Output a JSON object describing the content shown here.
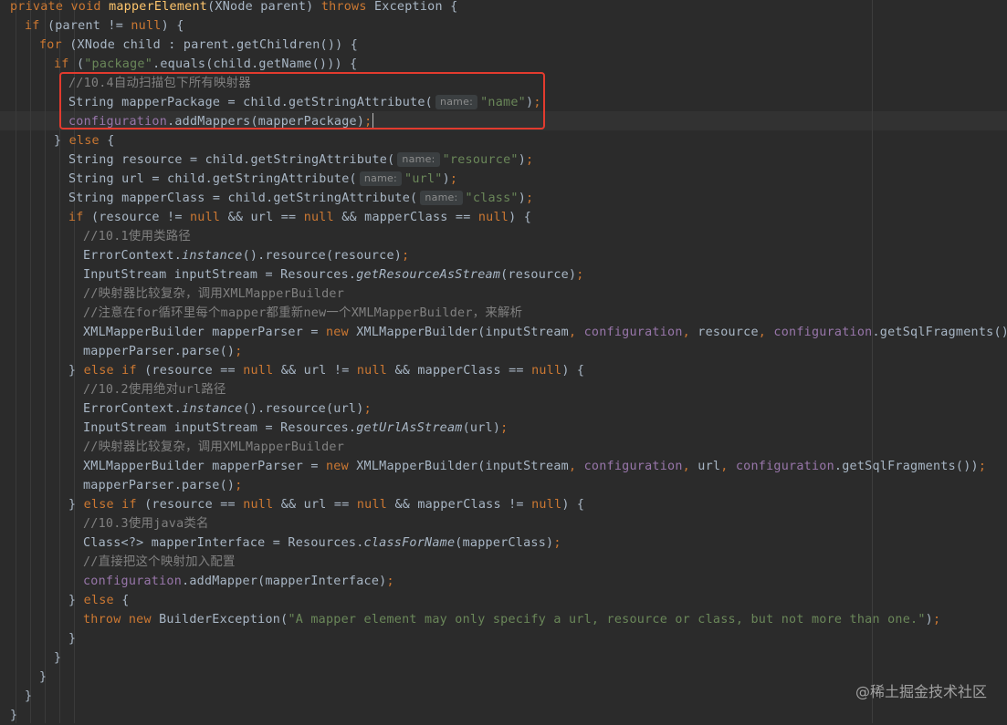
{
  "watermark": "@稀土掘金技术社区",
  "code": [
    [
      [
        "kw",
        "private void "
      ],
      [
        "fn",
        "mapperElement"
      ],
      [
        "p",
        "(XNode parent) "
      ],
      [
        "kw",
        "throws "
      ],
      [
        "p",
        "Exception {"
      ]
    ],
    [
      [
        "kw",
        "if "
      ],
      [
        "p",
        "(parent != "
      ],
      [
        "kw",
        "null"
      ],
      [
        "p",
        ") {"
      ]
    ],
    [
      [
        "kw",
        "for "
      ],
      [
        "p",
        "(XNode child : parent.getChildren()) {"
      ]
    ],
    [
      [
        "kw",
        "if "
      ],
      [
        "p",
        "("
      ],
      [
        "str",
        "\"package\""
      ],
      [
        "p",
        ".equals(child.getName())) {"
      ]
    ],
    [
      [
        "cm",
        "//10.4自动扫描包下所有映射器"
      ]
    ],
    [
      [
        "p",
        "String mapperPackage = child.getStringAttribute("
      ],
      [
        "hint",
        "name:"
      ],
      [
        "str",
        "\"name\""
      ],
      [
        "p",
        ")"
      ],
      [
        "kw",
        ";"
      ]
    ],
    [
      [
        "fld",
        "configuration"
      ],
      [
        "p",
        ".addMappers(mapperPackage)"
      ],
      [
        "kw",
        ";"
      ],
      [
        "caret",
        ""
      ]
    ],
    [
      [
        "p",
        "} "
      ],
      [
        "kw",
        "else "
      ],
      [
        "p",
        "{"
      ]
    ],
    [
      [
        "p",
        "String resource = child.getStringAttribute("
      ],
      [
        "hint",
        "name:"
      ],
      [
        "str",
        "\"resource\""
      ],
      [
        "p",
        ")"
      ],
      [
        "kw",
        ";"
      ]
    ],
    [
      [
        "p",
        "String url = child.getStringAttribute("
      ],
      [
        "hint",
        "name:"
      ],
      [
        "str",
        "\"url\""
      ],
      [
        "p",
        ")"
      ],
      [
        "kw",
        ";"
      ]
    ],
    [
      [
        "p",
        "String mapperClass = child.getStringAttribute("
      ],
      [
        "hint",
        "name:"
      ],
      [
        "str",
        "\"class\""
      ],
      [
        "p",
        ")"
      ],
      [
        "kw",
        ";"
      ]
    ],
    [
      [
        "kw",
        "if "
      ],
      [
        "p",
        "(resource != "
      ],
      [
        "kw",
        "null "
      ],
      [
        "p",
        "&& url == "
      ],
      [
        "kw",
        "null "
      ],
      [
        "p",
        "&& mapperClass == "
      ],
      [
        "kw",
        "null"
      ],
      [
        "p",
        ") {"
      ]
    ],
    [
      [
        "cm",
        "//10.1使用类路径"
      ]
    ],
    [
      [
        "p",
        "ErrorContext."
      ],
      [
        "it",
        "instance"
      ],
      [
        "p",
        "().resource(resource)"
      ],
      [
        "kw",
        ";"
      ]
    ],
    [
      [
        "p",
        "InputStream inputStream = Resources."
      ],
      [
        "it",
        "getResourceAsStream"
      ],
      [
        "p",
        "(resource)"
      ],
      [
        "kw",
        ";"
      ]
    ],
    [
      [
        "cm",
        "//映射器比较复杂，调用XMLMapperBuilder"
      ]
    ],
    [
      [
        "cm",
        "//注意在for循环里每个mapper都重新new一个XMLMapperBuilder，来解析"
      ]
    ],
    [
      [
        "p",
        "XMLMapperBuilder mapperParser = "
      ],
      [
        "kw",
        "new "
      ],
      [
        "p",
        "XMLMapperBuilder(inputStream"
      ],
      [
        "kw",
        ", "
      ],
      [
        "fld",
        "configuration"
      ],
      [
        "kw",
        ", "
      ],
      [
        "p",
        "resource"
      ],
      [
        "kw",
        ", "
      ],
      [
        "fld",
        "configuration"
      ],
      [
        "p",
        ".getSqlFragments())"
      ],
      [
        "kw",
        ";"
      ]
    ],
    [
      [
        "p",
        "mapperParser.parse()"
      ],
      [
        "kw",
        ";"
      ]
    ],
    [
      [
        "p",
        "} "
      ],
      [
        "kw",
        "else if "
      ],
      [
        "p",
        "(resource == "
      ],
      [
        "kw",
        "null "
      ],
      [
        "p",
        "&& url != "
      ],
      [
        "kw",
        "null "
      ],
      [
        "p",
        "&& mapperClass == "
      ],
      [
        "kw",
        "null"
      ],
      [
        "p",
        ") {"
      ]
    ],
    [
      [
        "cm",
        "//10.2使用绝对url路径"
      ]
    ],
    [
      [
        "p",
        "ErrorContext."
      ],
      [
        "it",
        "instance"
      ],
      [
        "p",
        "().resource(url)"
      ],
      [
        "kw",
        ";"
      ]
    ],
    [
      [
        "p",
        "InputStream inputStream = Resources."
      ],
      [
        "it",
        "getUrlAsStream"
      ],
      [
        "p",
        "(url)"
      ],
      [
        "kw",
        ";"
      ]
    ],
    [
      [
        "cm",
        "//映射器比较复杂，调用XMLMapperBuilder"
      ]
    ],
    [
      [
        "p",
        "XMLMapperBuilder mapperParser = "
      ],
      [
        "kw",
        "new "
      ],
      [
        "p",
        "XMLMapperBuilder(inputStream"
      ],
      [
        "kw",
        ", "
      ],
      [
        "fld",
        "configuration"
      ],
      [
        "kw",
        ", "
      ],
      [
        "p",
        "url"
      ],
      [
        "kw",
        ", "
      ],
      [
        "fld",
        "configuration"
      ],
      [
        "p",
        ".getSqlFragments())"
      ],
      [
        "kw",
        ";"
      ]
    ],
    [
      [
        "p",
        "mapperParser.parse()"
      ],
      [
        "kw",
        ";"
      ]
    ],
    [
      [
        "p",
        "} "
      ],
      [
        "kw",
        "else if "
      ],
      [
        "p",
        "(resource == "
      ],
      [
        "kw",
        "null "
      ],
      [
        "p",
        "&& url == "
      ],
      [
        "kw",
        "null "
      ],
      [
        "p",
        "&& mapperClass != "
      ],
      [
        "kw",
        "null"
      ],
      [
        "p",
        ") {"
      ]
    ],
    [
      [
        "cm",
        "//10.3使用java类名"
      ]
    ],
    [
      [
        "p",
        "Class<?> mapperInterface = Resources."
      ],
      [
        "it",
        "classForName"
      ],
      [
        "p",
        "(mapperClass)"
      ],
      [
        "kw",
        ";"
      ]
    ],
    [
      [
        "cm",
        "//直接把这个映射加入配置"
      ]
    ],
    [
      [
        "fld",
        "configuration"
      ],
      [
        "p",
        ".addMapper(mapperInterface)"
      ],
      [
        "kw",
        ";"
      ]
    ],
    [
      [
        "p",
        "} "
      ],
      [
        "kw",
        "else "
      ],
      [
        "p",
        "{"
      ]
    ],
    [
      [
        "kw",
        "throw new "
      ],
      [
        "p",
        "BuilderException("
      ],
      [
        "str",
        "\"A mapper element may only specify a url, resource or class, but not more than one.\""
      ],
      [
        "p",
        ")"
      ],
      [
        "kw",
        ";"
      ]
    ],
    [
      [
        "p",
        "}"
      ]
    ],
    [
      [
        "p",
        "}"
      ]
    ],
    [
      [
        "p",
        "}"
      ]
    ],
    [
      [
        "p",
        "}"
      ]
    ],
    [
      [
        "p",
        "}"
      ]
    ]
  ]
}
